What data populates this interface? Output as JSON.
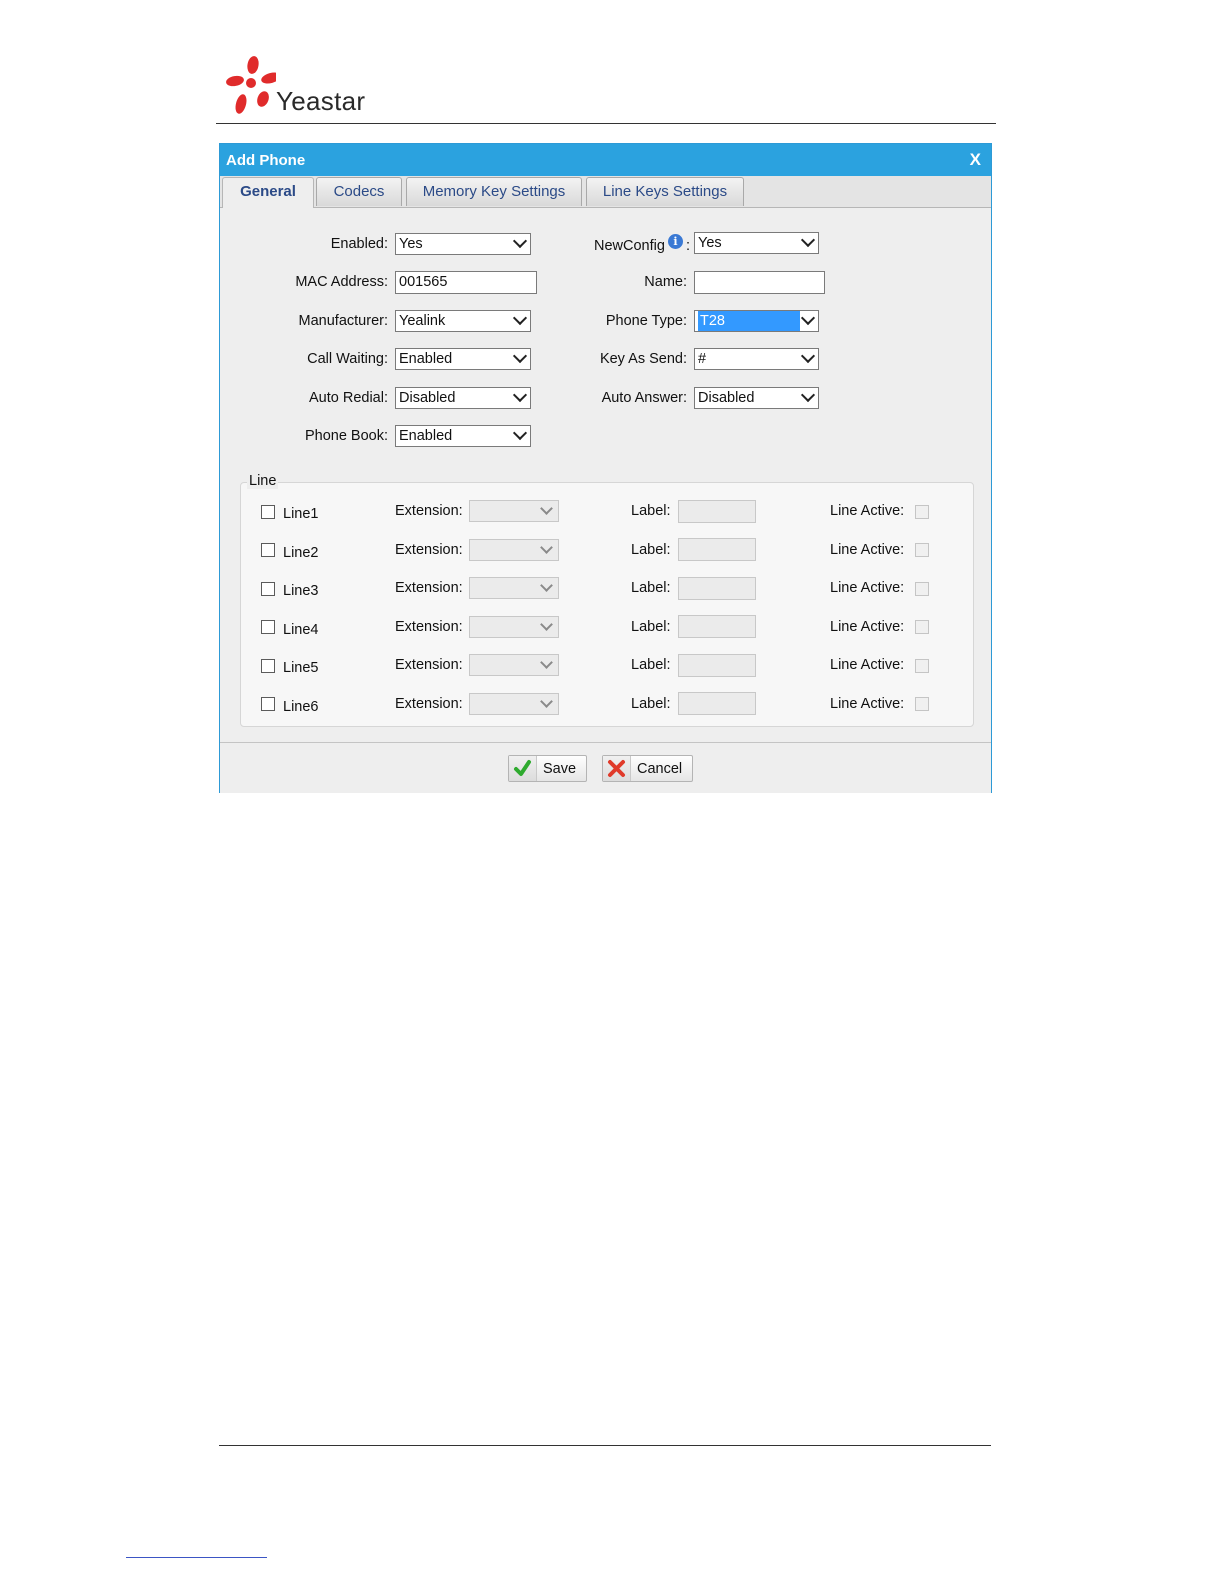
{
  "brand": {
    "name": "Yeastar"
  },
  "dialog": {
    "title": "Add Phone",
    "close": "X",
    "tabs": [
      {
        "label": "General",
        "active": true
      },
      {
        "label": "Codecs"
      },
      {
        "label": "Memory Key Settings"
      },
      {
        "label": "Line Keys Settings"
      }
    ],
    "left": {
      "enabled": {
        "label": "Enabled:",
        "value": "Yes"
      },
      "mac": {
        "label": "MAC Address:",
        "value": "001565"
      },
      "manufacturer": {
        "label": "Manufacturer:",
        "value": "Yealink"
      },
      "call_waiting": {
        "label": "Call Waiting:",
        "value": "Enabled"
      },
      "auto_redial": {
        "label": "Auto Redial:",
        "value": "Disabled"
      },
      "phone_book": {
        "label": "Phone Book:",
        "value": "Enabled"
      }
    },
    "right": {
      "newconfig": {
        "label": "NewConfig",
        "colon": ":",
        "value": "Yes"
      },
      "name": {
        "label": "Name:",
        "value": ""
      },
      "phone_type": {
        "label": "Phone Type:",
        "value": "T28"
      },
      "key_as_send": {
        "label": "Key As Send:",
        "value": "#"
      },
      "auto_answer": {
        "label": "Auto Answer:",
        "value": "Disabled"
      }
    },
    "line_group": {
      "legend": "Line",
      "extension_label": "Extension:",
      "label_label": "Label:",
      "line_active_label": "Line Active:",
      "lines": [
        {
          "name": "Line1"
        },
        {
          "name": "Line2"
        },
        {
          "name": "Line3"
        },
        {
          "name": "Line4"
        },
        {
          "name": "Line5"
        },
        {
          "name": "Line6"
        }
      ]
    },
    "buttons": {
      "save": "Save",
      "cancel": "Cancel"
    },
    "colors": {
      "titlebar": "#2ba2df",
      "tab_text": "#2b4a87",
      "selection": "#3399ff"
    }
  }
}
